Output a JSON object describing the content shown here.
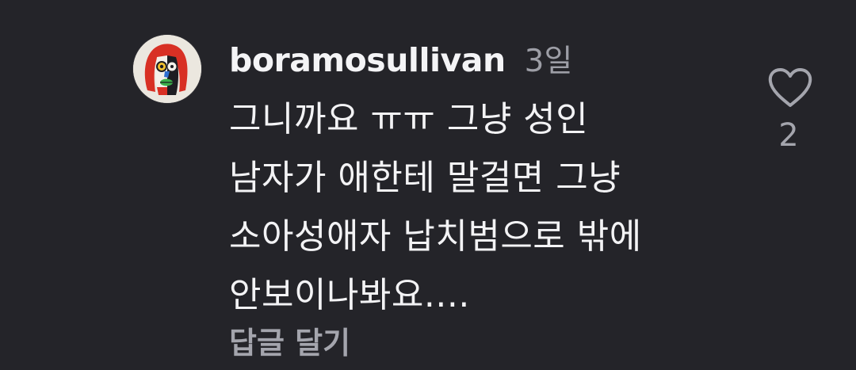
{
  "comment": {
    "username": "boramosullivan",
    "timestamp": "3일",
    "text_lines": [
      "그니까요 ㅠㅠ 그냥 성인",
      "남자가 애한테 말걸면 그냥",
      "소아성애자 납치범으로 밖에",
      "안보이나봐요...."
    ],
    "reply_label": "답글 달기",
    "like_count": "2",
    "icons": {
      "like": "heart-outline-icon",
      "avatar": "abstract-face-avatar"
    }
  },
  "colors": {
    "background": "#242429",
    "text_primary": "#f3f3f5",
    "text_secondary": "#a4a5ad"
  }
}
